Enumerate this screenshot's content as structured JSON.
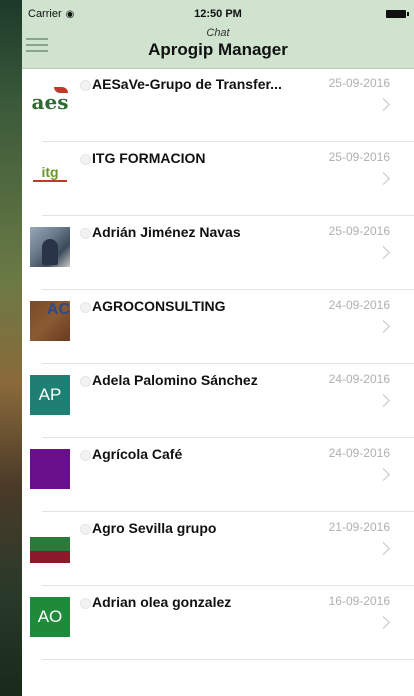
{
  "status_bar": {
    "carrier": "Carrier",
    "time": "12:50 PM"
  },
  "nav": {
    "subtitle": "Chat",
    "title": "Aprogip Manager"
  },
  "chats": [
    {
      "name": "AESaVe-Grupo de Transfer...",
      "date": "25-09-2016",
      "avatar_text": "aes"
    },
    {
      "name": "ITG FORMACION",
      "date": "25-09-2016",
      "avatar_text": "itg"
    },
    {
      "name": "Adrián Jiménez Navas",
      "date": "25-09-2016",
      "avatar_text": ""
    },
    {
      "name": "AGROCONSULTING",
      "date": "24-09-2016",
      "avatar_text": "AC"
    },
    {
      "name": "Adela Palomino Sánchez",
      "date": "24-09-2016",
      "avatar_text": "AP"
    },
    {
      "name": "Agrícola Café",
      "date": "24-09-2016",
      "avatar_text": ""
    },
    {
      "name": "Agro Sevilla grupo",
      "date": "21-09-2016",
      "avatar_text": ""
    },
    {
      "name": "Adrian olea gonzalez",
      "date": "16-09-2016",
      "avatar_text": "AO"
    }
  ],
  "colors": {
    "nav_background": "#cfe3cf",
    "avatar_ap": "#1f7f74",
    "avatar_ao": "#1f8a3a",
    "avatar_cafe": "#6a0f8a"
  }
}
